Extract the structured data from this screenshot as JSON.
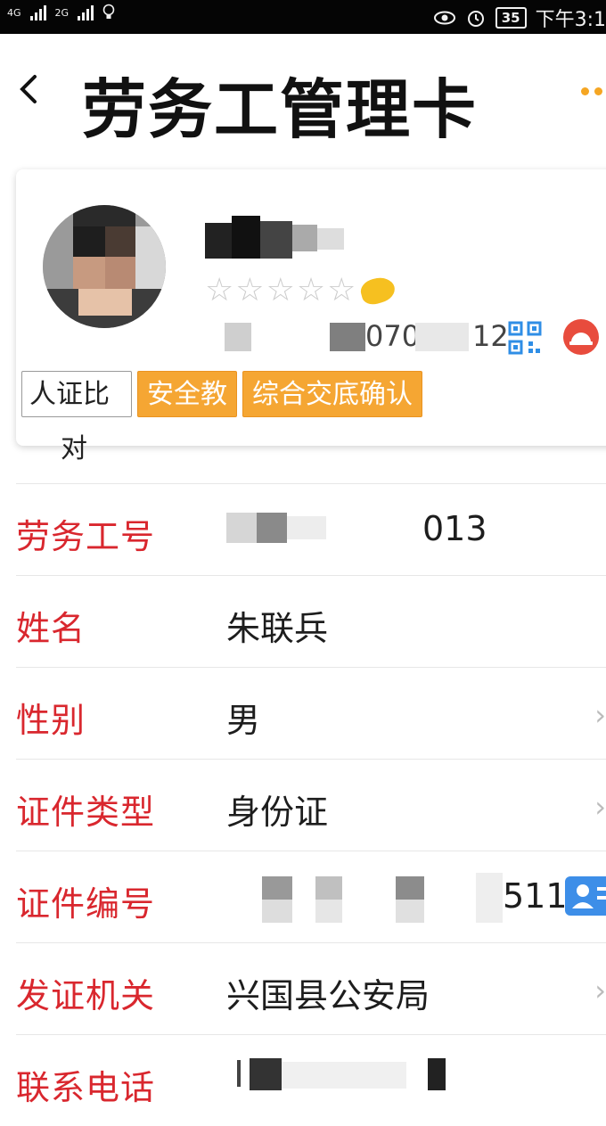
{
  "status_bar": {
    "network_1": "4G",
    "network_2": "2G",
    "battery": "35",
    "time": "下午3:1"
  },
  "header": {
    "title": "劳务工管理卡"
  },
  "profile": {
    "id_visible_prefix": "070",
    "id_visible_suffix": "12",
    "star_count": 5,
    "buttons": {
      "face_match": "人证比",
      "face_match_wrap": "对",
      "safety_training": "安全教",
      "briefing_confirm": "综合交底确认"
    }
  },
  "fields": [
    {
      "label": "劳务工号",
      "value": "013"
    },
    {
      "label": "姓名",
      "value": "朱联兵"
    },
    {
      "label": "性别",
      "value": "男"
    },
    {
      "label": "证件类型",
      "value": "身份证"
    },
    {
      "label": "证件编号",
      "value": "511"
    },
    {
      "label": "发证机关",
      "value": "兴国县公安局"
    },
    {
      "label": "联系电话",
      "value": ""
    }
  ],
  "colors": {
    "label_red": "#d9272e",
    "accent_orange": "#f5a633",
    "helmet_red": "#e84c3d",
    "contact_blue": "#3d8ee8"
  }
}
